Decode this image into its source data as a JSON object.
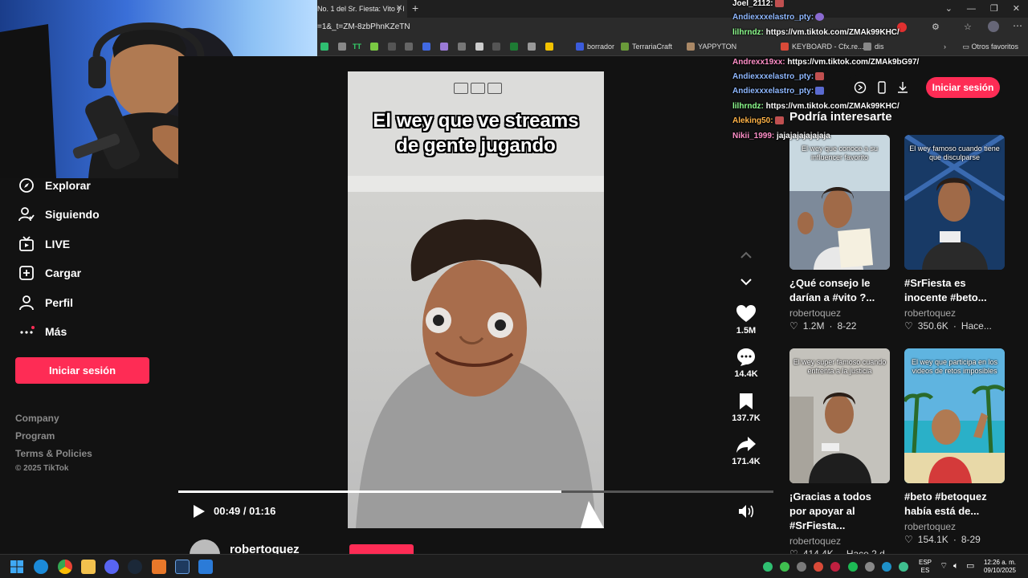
{
  "browser": {
    "tab_title": "No. 1 del Sr. Fiesta: Vito y l",
    "tab_close": "✕",
    "new_tab": "+",
    "url": "=1&_t=ZM-8zbPhnKZeTN",
    "bookmarks": [
      "TT",
      "borrador",
      "TerrariaCraft",
      "YAPPYTON",
      "KEYBOARD - Cfx.re...",
      "dis"
    ],
    "others": "Otros favoritos"
  },
  "sidebar": {
    "items": [
      {
        "label": "Explorar",
        "icon": "compass-icon"
      },
      {
        "label": "Siguiendo",
        "icon": "user-follow-icon"
      },
      {
        "label": "LIVE",
        "icon": "live-tv-icon"
      },
      {
        "label": "Cargar",
        "icon": "upload-plus-icon"
      },
      {
        "label": "Perfil",
        "icon": "profile-icon"
      },
      {
        "label": "Más",
        "icon": "more-dots-icon"
      }
    ],
    "login_label": "Iniciar sesión",
    "footer": [
      "Company",
      "Program",
      "Terms & Policies"
    ],
    "copyright": "© 2025 TikTok"
  },
  "video": {
    "caption_line1": "El wey que ve streams",
    "caption_line2": "de gente jugando",
    "time": "00:49 / 01:16",
    "progress": 0.644,
    "author": "robertoquez"
  },
  "actions": [
    {
      "name": "like",
      "count": "1.5M"
    },
    {
      "name": "comment",
      "count": "14.4K"
    },
    {
      "name": "bookmark",
      "count": "137.7K"
    },
    {
      "name": "share",
      "count": "171.4K"
    }
  ],
  "right": {
    "login_label": "Iniciar sesión",
    "section_title": "Podría interesarte",
    "cards": [
      {
        "thumb_caption": "El wey que conoce a su influencer favorito",
        "title": "¿Qué consejo le darían a #vito ?...",
        "author": "robertoquez",
        "likes": "1.2M",
        "date": "8-22",
        "thumb_color": "#8a8f96"
      },
      {
        "thumb_caption": "El wey famoso cuando tiene que disculparse",
        "title": "#SrFiesta es inocente #beto...",
        "author": "robertoquez",
        "likes": "350.6K",
        "date": "Hace...",
        "thumb_color": "#1d3c6b"
      },
      {
        "thumb_caption": "El wey super famoso cuando enfrenta a la justicia",
        "title": "¡Gracias a todos por apoyar al #SrFiesta...",
        "author": "robertoquez",
        "likes": "414.4K",
        "date": "Hace 2 d",
        "thumb_color": "#c9c9c7"
      },
      {
        "thumb_caption": "El wey que participa en los videos de retos imposibles",
        "title": "#beto #betoquez había está de...",
        "author": "robertoquez",
        "likes": "154.1K",
        "date": "8-29",
        "thumb_color": "#2a8bb8"
      }
    ]
  },
  "chat": [
    {
      "user": "Joel_2112:",
      "msg": "",
      "color": "#ffffff"
    },
    {
      "user": "Andiexxxelastro_pty:",
      "msg": "",
      "color": "#8fb8ff"
    },
    {
      "user": "lilhrndz:",
      "msg": "https://vm.tiktok.com/ZMAk99KHC/",
      "color": "#8fff8f"
    },
    {
      "user": "Andrexx19xx:",
      "msg": "https://vm.tiktok.com/ZMAk9bG97/",
      "color": "#ff8fc8"
    },
    {
      "user": "Andiexxxelastro_pty:",
      "msg": "",
      "color": "#8fb8ff"
    },
    {
      "user": "Andiexxxelastro_pty:",
      "msg": "",
      "color": "#8fb8ff"
    },
    {
      "user": "lilhrndz:",
      "msg": "https://vm.tiktok.com/ZMAk99KHC/",
      "color": "#8fff8f"
    },
    {
      "user": "Aleking50:",
      "msg": "",
      "color": "#ffb347"
    },
    {
      "user": "Nikii_1999:",
      "msg": "jajajajajajajaja",
      "color": "#ff8fc8"
    }
  ],
  "taskbar": {
    "lang": "ESP",
    "lang2": "ES",
    "time": "12:26 a. m.",
    "date": "09/10/2025"
  }
}
